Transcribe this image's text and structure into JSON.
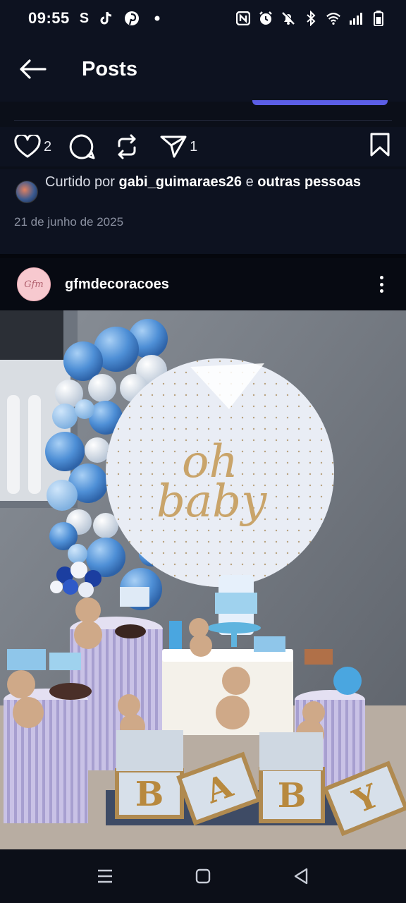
{
  "status_bar": {
    "time": "09:55",
    "left_icons": [
      "s-app-icon",
      "tiktok-icon",
      "pinterest-icon",
      "dot-icon"
    ],
    "right_icons": [
      "nfc-icon",
      "alarm-icon",
      "mute-icon",
      "bluetooth-icon",
      "wifi-icon",
      "signal-icon",
      "battery-icon"
    ],
    "s_letter": "S"
  },
  "header": {
    "title": "Posts"
  },
  "actions": {
    "like_count": "2",
    "share_count": "1"
  },
  "likes": {
    "prefix": "Curtido por ",
    "user": "gabi_guimaraes26",
    "middle": " e ",
    "suffix": "outras pessoas"
  },
  "post": {
    "date": "21 de junho de 2025"
  },
  "next_post": {
    "author": "gfmdecoracoes",
    "avatar_text": "Gfm"
  },
  "photo": {
    "sign_line1": "oh",
    "sign_line2": "baby",
    "blocks": [
      "B",
      "A",
      "B",
      "Y"
    ]
  },
  "colors": {
    "background": "#0b0f19",
    "accent": "#5b5ee6",
    "balloon_blue": "#5b9fe0",
    "balloon_white": "#e8eef6",
    "gold": "#c9a46a"
  }
}
